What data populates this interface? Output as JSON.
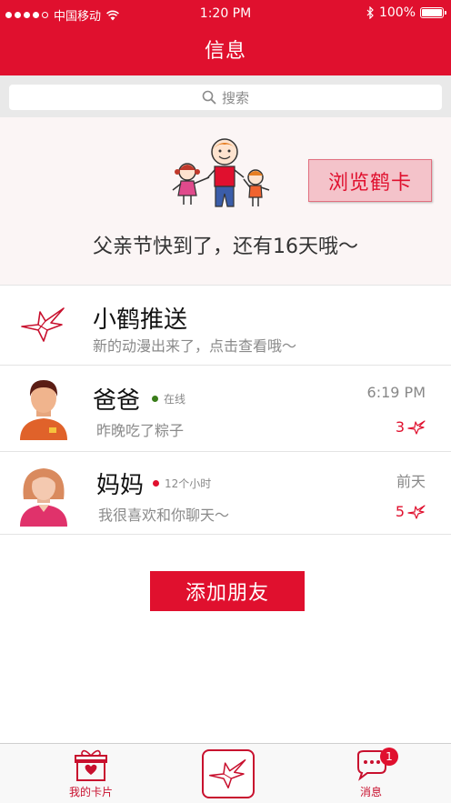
{
  "status_bar": {
    "carrier": "中国移动",
    "time": "1:20 PM",
    "battery": "100%"
  },
  "nav": {
    "title": "信息"
  },
  "search": {
    "placeholder": "搜索"
  },
  "banner": {
    "button_label": "浏览鹤卡",
    "text": "父亲节快到了，还有16天哦～"
  },
  "list": [
    {
      "name": "小鹤推送",
      "preview": "新的动漫出来了，点击查看哦～"
    },
    {
      "name": "爸爸",
      "status": "在线",
      "status_color": "#3a7d1a",
      "preview": "昨晚吃了粽子",
      "time": "6:19 PM",
      "count": "3"
    },
    {
      "name": "妈妈",
      "status": "12个小时",
      "status_color": "#e0102e",
      "preview": "我很喜欢和你聊天～",
      "time": "前天",
      "count": "5"
    }
  ],
  "add_friend_label": "添加朋友",
  "tabs": {
    "cards_label": "我的卡片",
    "messages_label": "消息",
    "messages_badge": "1"
  },
  "colors": {
    "brand": "#e0102e"
  }
}
